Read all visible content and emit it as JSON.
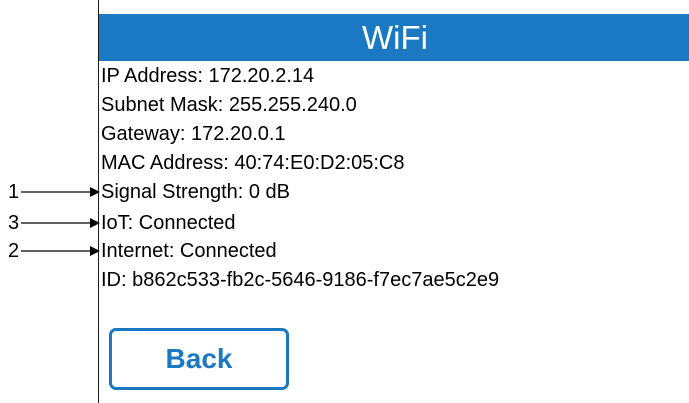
{
  "header": {
    "title": "WiFi"
  },
  "info": {
    "ip_address": "IP Address: 172.20.2.14",
    "subnet_mask": "Subnet Mask: 255.255.240.0",
    "gateway": "Gateway: 172.20.0.1",
    "mac_address": "MAC Address: 40:74:E0:D2:05:C8",
    "signal_strength": "Signal Strength: 0 dB",
    "iot": "IoT: Connected",
    "internet": "Internet: Connected",
    "id": "ID: b862c533-fb2c-5646-9186-f7ec7ae5c2e9"
  },
  "back_button": {
    "label": "Back"
  },
  "callouts": {
    "signal_strength": "1",
    "iot": "3",
    "internet": "2"
  },
  "colors": {
    "accent": "#1b78c2",
    "text": "#000000",
    "background": "#ffffff"
  }
}
